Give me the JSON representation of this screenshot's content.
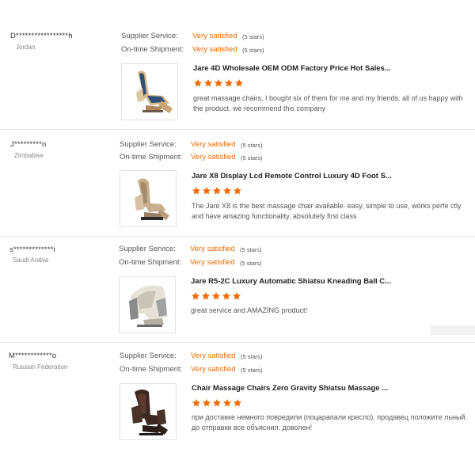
{
  "labels": {
    "supplier_service": "Supplier Service:",
    "ontime_shipment": "On-time Shipment:"
  },
  "colors": {
    "accent": "#f06a00",
    "star": "#f06a00",
    "divider": "#e6e6e6"
  },
  "reviews": [
    {
      "buyer": "D*****************h",
      "country": "Jordan",
      "supplier_rating": "Very satisfied",
      "supplier_stars": "(5 stars)",
      "shipment_rating": "Very satisfied",
      "shipment_stars": "(5 stars)",
      "product_title": "Jare 4D Wholesale OEM ODM Factory Price Hot Sales...",
      "product_image": "massage-chair-blue-beige",
      "stars": 5,
      "comment": "great massage chairs, I bought six of them for me and my friends. all of us happy with the product. we recommend this company"
    },
    {
      "buyer": "J*********n",
      "country": "Zimbabwe",
      "supplier_rating": "Very satisfied",
      "supplier_stars": "(5 stars)",
      "shipment_rating": "Very satisfied",
      "shipment_stars": "(5 stars)",
      "product_title": "Jare X8 Display Lcd Remote Control Luxury 4D Foot S...",
      "product_image": "massage-chair-champagne",
      "stars": 5,
      "comment": "The Jare X8 is the best massage chair available. easy, simple to use, works perfe ctly and have amazing functionality. absolutely first class"
    },
    {
      "buyer": "s*************i",
      "country": "Saudi Arabia",
      "supplier_rating": "Very satisfied",
      "supplier_stars": "(5 stars)",
      "shipment_rating": "Very satisfied",
      "shipment_stars": "(5 stars)",
      "product_title": "Jare R5-2C Luxury Automatic Shiatsu Kneading Ball C...",
      "product_image": "massage-chair-white-grey",
      "stars": 5,
      "comment": "great service and AMAZING product!"
    },
    {
      "buyer": "M************o",
      "country": "Russian Federation",
      "supplier_rating": "Very satisfied",
      "supplier_stars": "(5 stars)",
      "shipment_rating": "Very satisfied",
      "shipment_stars": "(5 stars)",
      "product_title": "Chair Massage Chairs Zero Gravity Shiatsu Massage ...",
      "product_image": "massage-chair-dark-brown",
      "stars": 5,
      "comment": "при доставке немного повредили (поцарапали кресло). продавец положите льный. до отправки все объяснил. доволен!"
    }
  ]
}
